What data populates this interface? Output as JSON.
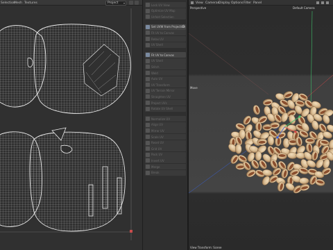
{
  "uv_editor": {
    "menus": [
      "Selection",
      "Mesh",
      "Textures"
    ],
    "projection_select": {
      "value": "Project"
    }
  },
  "tools": [
    {
      "label": "Lock UV View",
      "active": false
    },
    {
      "label": "Optimize UV Map",
      "active": false
    },
    {
      "label": "Unfold Selection",
      "active": false
    },
    {
      "label": "Set UVW from Projection",
      "active": true,
      "gear": true
    },
    {
      "label": "Fit UV to Canvas",
      "active": false
    },
    {
      "label": "Relax UV",
      "active": false
    },
    {
      "label": "UV Shell",
      "active": false
    },
    {
      "label": "Fit UV to Canvas",
      "active": true
    },
    {
      "label": "UV Shell",
      "active": false
    },
    {
      "label": "Stitch",
      "active": false
    },
    {
      "label": "Weld",
      "active": false
    },
    {
      "label": "Auto UV",
      "active": false
    },
    {
      "label": "UV Transform",
      "active": false
    },
    {
      "label": "UV Terrain Mirror",
      "active": false
    },
    {
      "label": "Straighten UV",
      "active": false
    },
    {
      "label": "Project UVs",
      "active": false
    },
    {
      "label": "Rotate UV Shell",
      "active": false
    },
    {
      "label": "Normalize UV",
      "active": false
    },
    {
      "label": "Align UV",
      "active": false
    },
    {
      "label": "Mirror UV",
      "active": false
    },
    {
      "label": "Scale UV",
      "active": false
    },
    {
      "label": "Reset UV",
      "active": false
    },
    {
      "label": "Grid UV",
      "active": false
    },
    {
      "label": "Pack UV",
      "active": false
    },
    {
      "label": "Invert UV",
      "active": false
    },
    {
      "label": "Merge",
      "active": false
    },
    {
      "label": "Break",
      "active": false
    }
  ],
  "viewport": {
    "menus": [
      "View",
      "Cameras",
      "Display",
      "Options",
      "Filter",
      "Panel"
    ],
    "view_name": "Perspective",
    "camera_name": "Default Camera",
    "axis_label": "Move",
    "footer": "View Transform: Scene"
  },
  "colors": {
    "uv_wire": "#d9d9d9",
    "axis_x": "#d84848",
    "axis_y": "#3fc06a",
    "axis_z": "#3a62d8",
    "pistachio_shell": "#d7b98e",
    "pistachio_inner": "#8a4f2e"
  }
}
